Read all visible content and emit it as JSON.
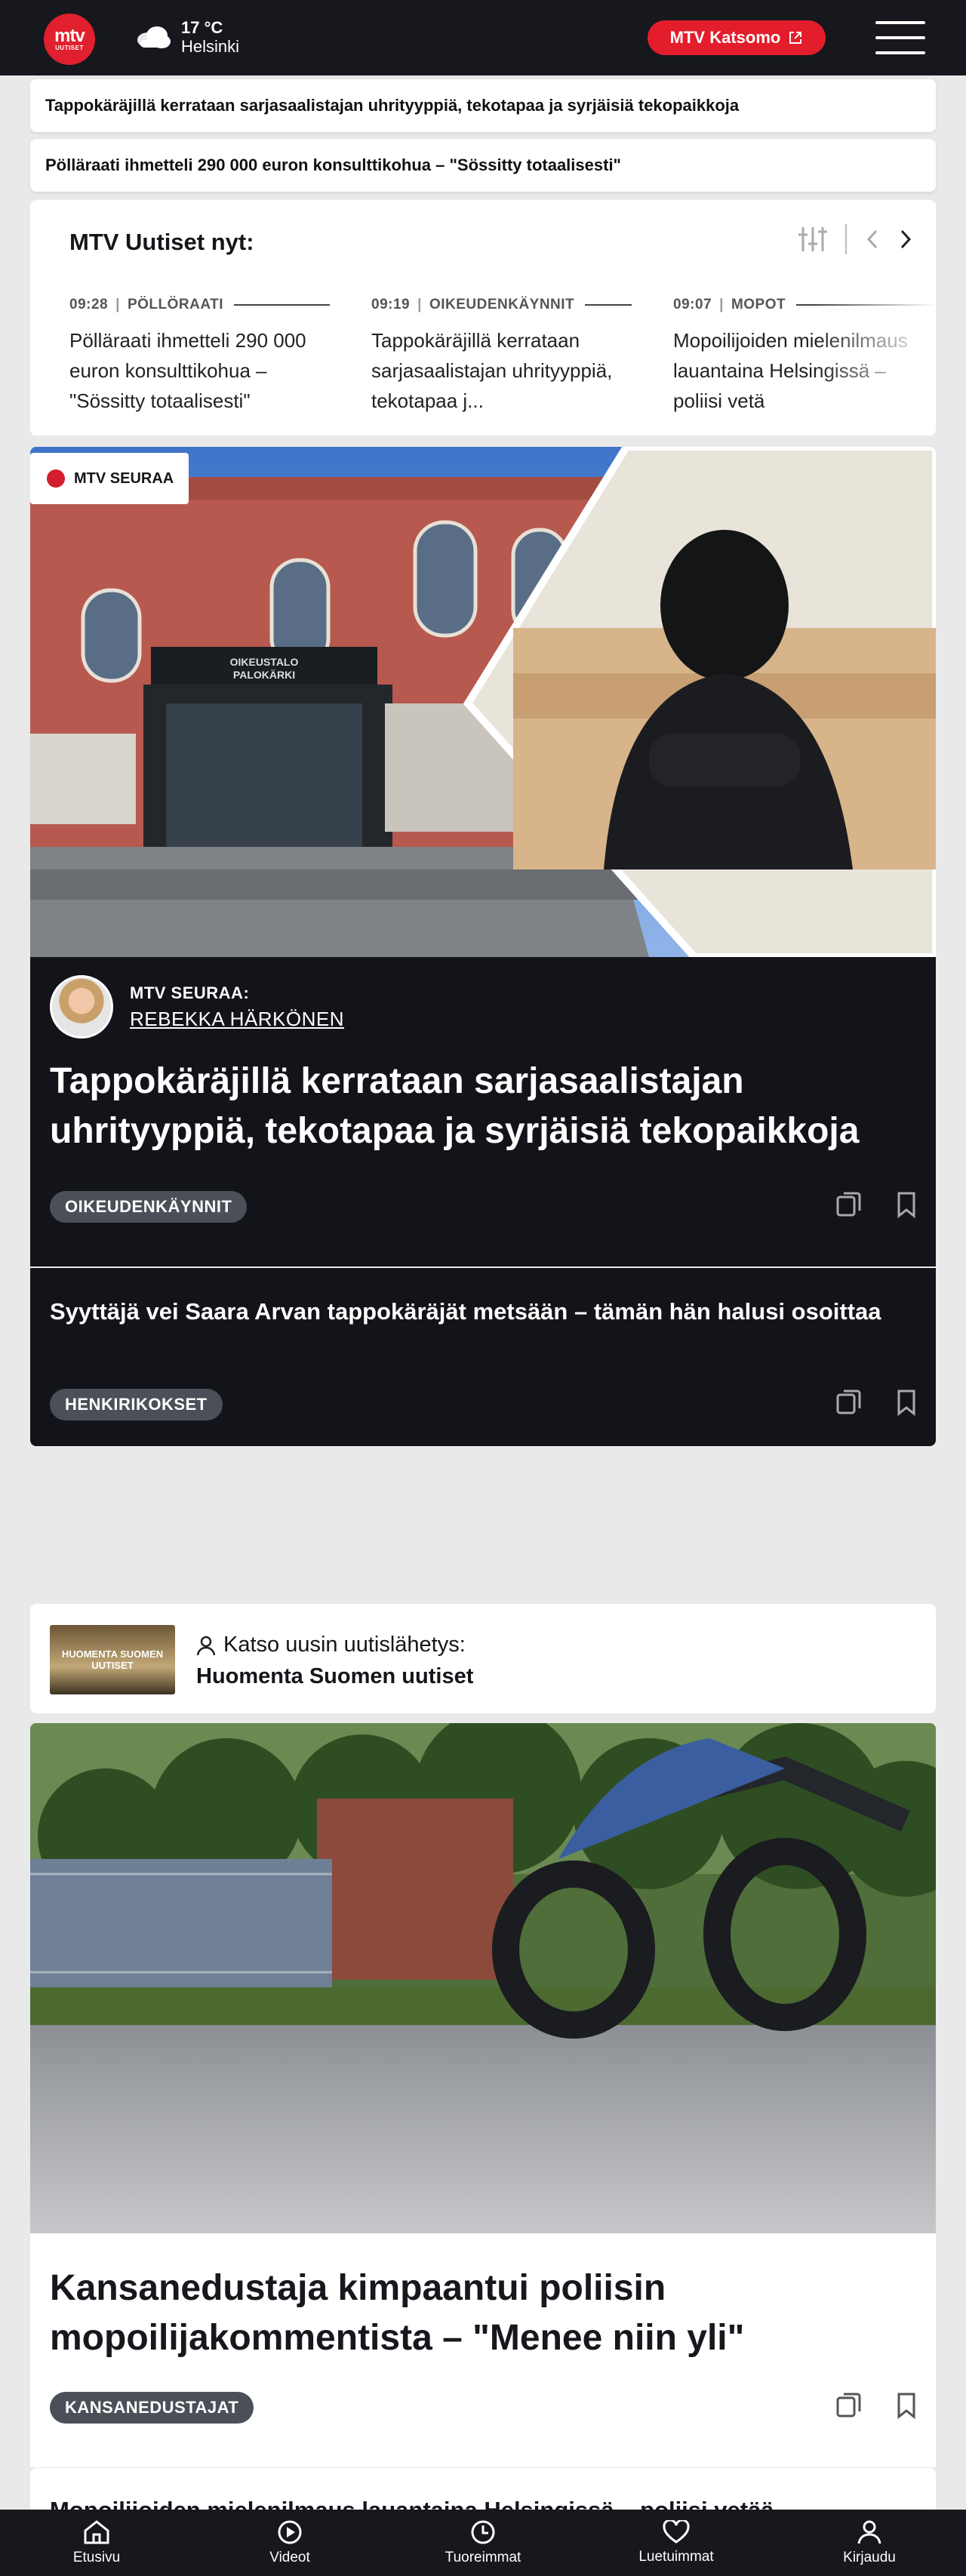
{
  "header": {
    "logo_top": "mtv",
    "logo_bottom": "UUTISET",
    "weather_temp": "17 °C",
    "weather_city": "Helsinki",
    "katsomo_label": "MTV Katsomo"
  },
  "breaking": [
    "Tappokäräjillä kerrataan sarjasaalistajan uhrityyppiä, tekotapaa ja syrjäisiä tekopaikkoja",
    "Pölläraati ihmetteli 290 000 euron konsulttikohua – \"Sössitty totaalisesti\""
  ],
  "news_now": {
    "title": "MTV Uutiset nyt:",
    "items": [
      {
        "time": "09:28",
        "category": "PÖLLÖRAATI",
        "text": "Pölläraati ihmetteli 290 000 euron konsulttikohua – \"Sössitty totaalisesti\""
      },
      {
        "time": "09:19",
        "category": "OIKEUDENKÄYNNIT",
        "text": "Tappokäräjillä kerrataan sarjasaalistajan uhrityyppiä, tekotapaa j..."
      },
      {
        "time": "09:07",
        "category": "MOPOT",
        "text": "Mopoilijoiden mielenilmaus lauantaina Helsingissä – poliisi vetä"
      }
    ]
  },
  "main_article": {
    "badge": "MTV SEURAA",
    "building_sign_1": "OIKEUSTALO",
    "building_sign_2": "PALOKÄRKI",
    "follow_label": "MTV SEURAA:",
    "author": "REBEKKA HÄRKÖNEN",
    "title": "Tappokäräjillä kerrataan sarjasaalistajan uhrityyppiä, tekotapaa ja syrjäisiä tekopaikkoja",
    "tag": "OIKEUDENKÄYNNIT"
  },
  "related_article": {
    "title": "Syyttäjä vei Saara Arvan tappokäräjät metsään – tämän hän halusi osoittaa",
    "tag": "HENKIRIKOKSET"
  },
  "newscast": {
    "thumb_label": "HUOMENTA SUOMEN UUTISET",
    "label": "Katso uusin uutislähetys:",
    "title": "Huomenta Suomen uutiset"
  },
  "second_article": {
    "title": "Kansanedustaja kimpaantui poliisin mopoilijakommentista – \"Menee niin yli\"",
    "tag": "KANSANEDUSTAJAT",
    "next_peek": "Mopoilijoiden mielenilmaus lauantaina Helsingissä – poliisi vetää"
  },
  "bottom_nav": [
    "Etusivu",
    "Videot",
    "Tuoreimmat",
    "Luetuimmat",
    "Kirjaudu"
  ],
  "colors": {
    "brand_red": "#e31d2b",
    "dark": "#121419",
    "tag_bg": "#4b5058"
  }
}
